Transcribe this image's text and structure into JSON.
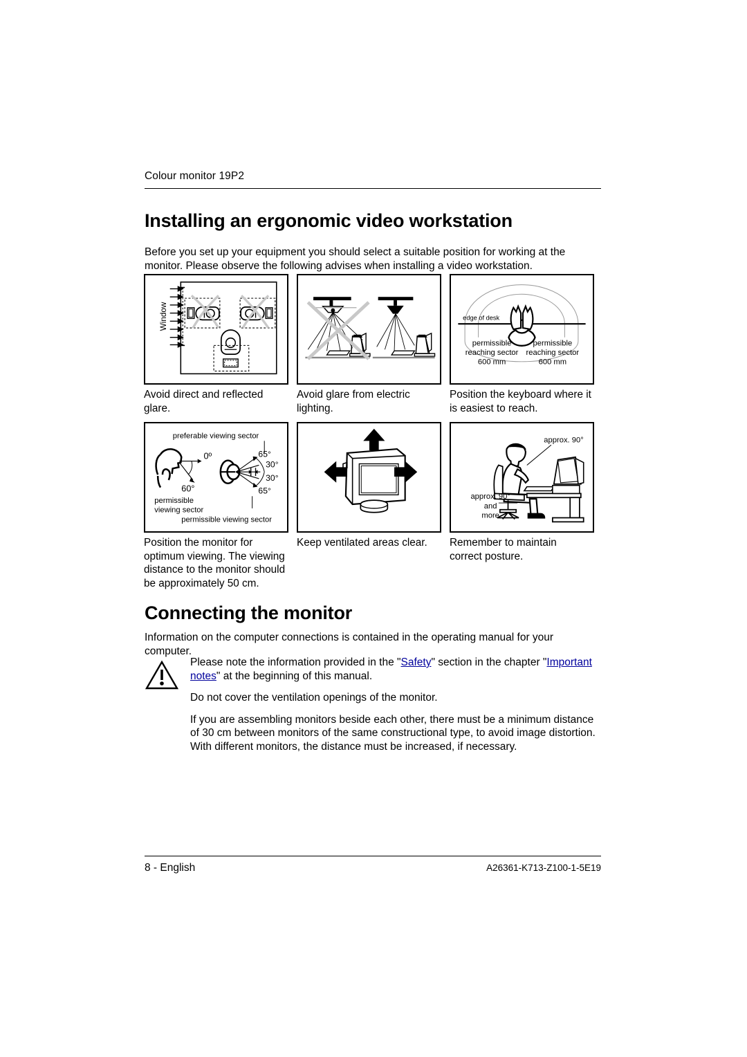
{
  "header": {
    "running_head": "Colour monitor 19P2"
  },
  "sections": {
    "ergonomic": {
      "title": "Installing an ergonomic video workstation",
      "intro": "Before you set up your equipment you should select a suitable position for working at the monitor. Please observe the following advises when installing a video workstation."
    },
    "connecting": {
      "title": "Connecting the monitor",
      "intro": "Information on the computer connections is contained in the operating manual for your computer."
    }
  },
  "figures": [
    {
      "id": "avoid-glare-window",
      "caption": "Avoid direct and reflected glare.",
      "labels": {
        "window": "Window"
      }
    },
    {
      "id": "avoid-glare-lighting",
      "caption": "Avoid glare from electric lighting.",
      "labels": {}
    },
    {
      "id": "keyboard-reach",
      "caption": "Position the keyboard where it is easiest to reach.",
      "labels": {
        "edge_of_desk": "edge of desk",
        "left_sector_line1": "permissible",
        "left_sector_line2": "reaching sector",
        "left_sector_line3": "600 mm",
        "right_sector_line1": "permissible",
        "right_sector_line2": "reaching sector",
        "right_sector_line3": "600 mm"
      }
    },
    {
      "id": "viewing-sector",
      "caption": "Position the monitor for optimum viewing. The viewing distance to the monitor should be approximately 50 cm.",
      "labels": {
        "preferable_viewing_sector": "preferable viewing sector",
        "angle_0": "0º",
        "angle_60": "60°",
        "permissible_line1": "permissible",
        "permissible_line2": "viewing sector",
        "angle_65_top": "65°",
        "angle_30_top": "30°",
        "angle_30_bottom": "30°",
        "angle_65_bottom": "65°",
        "permissible_viewing_sector": "permissible viewing sector"
      }
    },
    {
      "id": "ventilation",
      "caption": "Keep ventilated areas clear.",
      "labels": {}
    },
    {
      "id": "posture",
      "caption": "Remember to maintain correct posture.",
      "labels": {
        "approx_90_top": "approx. 90°",
        "approx_90_left_line1": "approx. 90°",
        "approx_90_left_line2": "and",
        "approx_90_left_line3": "more"
      }
    }
  ],
  "note": {
    "warning_icon": "warning-triangle-icon",
    "paragraph_1": {
      "part_1": "Please note the information provided in the \"",
      "link_1": "Safety",
      "part_2": "\" section in the chapter \"",
      "link_2": "Important notes",
      "part_3": "\" at the beginning of this manual."
    },
    "paragraph_2": "Do not cover the ventilation openings of the monitor.",
    "paragraph_3": "If you are assembling monitors beside each other, there must be a minimum distance of 30 cm between monitors of the same constructional type, to avoid image distortion. With different monitors, the distance must be increased, if necessary."
  },
  "footer": {
    "page_label": "8 - English",
    "document_number": "A26361-K713-Z100-1-5E19"
  },
  "colors": {
    "text": "#000000",
    "link": "#00009c",
    "rule": "#000000",
    "figure_light_gray": "#c8c8c8"
  }
}
